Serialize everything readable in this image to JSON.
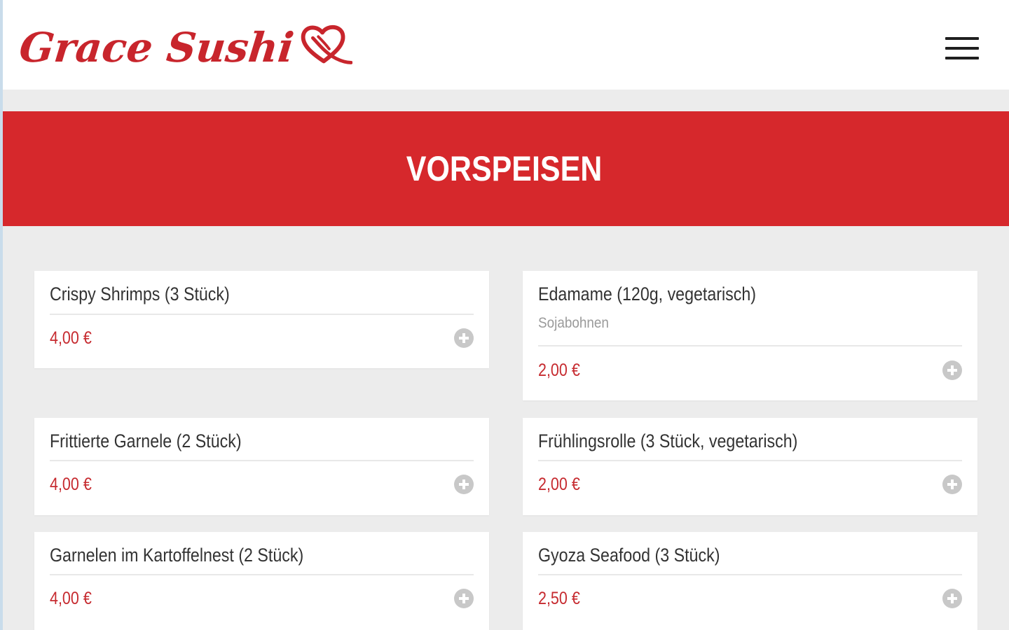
{
  "header": {
    "logo_text": "Grace Sushi",
    "logo_icon": "heart-logo-icon",
    "menu_icon": "hamburger-menu-icon"
  },
  "banner": {
    "title": "VORSPEISEN"
  },
  "menu_items": [
    {
      "name": "Crispy Shrimps (3 Stück)",
      "description": "",
      "price": "4,00 €"
    },
    {
      "name": "Edamame (120g, vegetarisch)",
      "description": "Sojabohnen",
      "price": "2,00 €"
    },
    {
      "name": "Frittierte Garnele (2 Stück)",
      "description": "",
      "price": "4,00 €"
    },
    {
      "name": "Frühlingsrolle (3 Stück, vegetarisch)",
      "description": "",
      "price": "2,00 €"
    },
    {
      "name": "Garnelen im Kartoffelnest (2 Stück)",
      "description": "",
      "price": "4,00 €"
    },
    {
      "name": "Gyoza Seafood (3 Stück)",
      "description": "",
      "price": "2,50 €"
    }
  ],
  "colors": {
    "brand_red": "#d6282c",
    "price_red": "#c62a2f",
    "page_background": "#ececec"
  }
}
